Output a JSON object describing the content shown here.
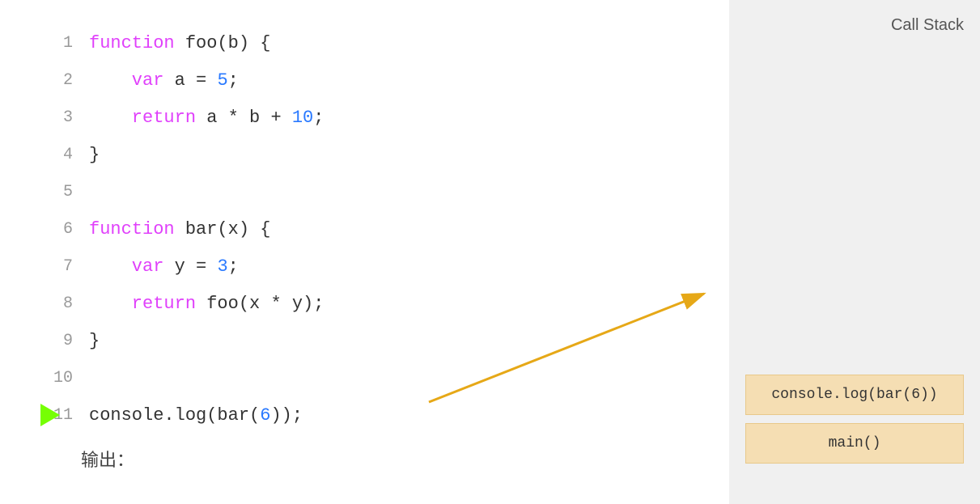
{
  "callStack": {
    "title": "Call Stack",
    "items": [
      {
        "label": "console.log(bar(6))"
      },
      {
        "label": "main()"
      }
    ]
  },
  "code": {
    "lines": [
      {
        "num": "1",
        "content": "function foo(b) {"
      },
      {
        "num": "2",
        "content": "    var a = 5;"
      },
      {
        "num": "3",
        "content": "    return a * b + 10;"
      },
      {
        "num": "4",
        "content": "}"
      },
      {
        "num": "5",
        "content": ""
      },
      {
        "num": "6",
        "content": "function bar(x) {"
      },
      {
        "num": "7",
        "content": "    var y = 3;"
      },
      {
        "num": "8",
        "content": "    return foo(x * y);"
      },
      {
        "num": "9",
        "content": "}"
      },
      {
        "num": "10",
        "content": ""
      },
      {
        "num": "11",
        "content": "console.log(bar(6));"
      }
    ],
    "currentLine": 11
  },
  "output": {
    "label": "输出："
  }
}
